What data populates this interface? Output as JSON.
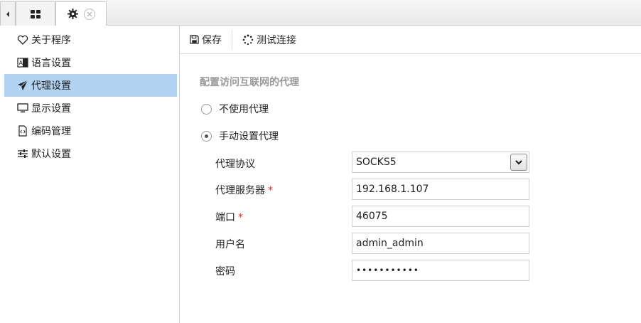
{
  "tabbar": {
    "apps_icon": "grid-icon",
    "settings_icon": "gear-icon",
    "close_icon": "close-icon"
  },
  "sidebar": {
    "items": [
      {
        "label": "关于程序",
        "icon": "heart-icon"
      },
      {
        "label": "语言设置",
        "icon": "language-icon"
      },
      {
        "label": "代理设置",
        "icon": "paper-plane-icon",
        "active": true
      },
      {
        "label": "显示设置",
        "icon": "monitor-icon"
      },
      {
        "label": "编码管理",
        "icon": "code-file-icon"
      },
      {
        "label": "默认设置",
        "icon": "sliders-icon"
      }
    ]
  },
  "toolbar": {
    "save_label": "保存",
    "test_label": "测试连接"
  },
  "proxy": {
    "section_title": "配置访问互联网的代理",
    "option_none": "不使用代理",
    "option_manual": "手动设置代理",
    "selected": "manual",
    "protocol_label": "代理协议",
    "protocol_value": "SOCKS5",
    "server_label": "代理服务器",
    "server_value": "192.168.1.107",
    "port_label": "端口",
    "port_value": "46075",
    "username_label": "用户名",
    "username_value": "admin_admin",
    "password_label": "密码",
    "password_value": "•••••••••••",
    "required_mark": "*"
  },
  "colors": {
    "active_item_bg": "#b3d3f3",
    "required": "#e03030",
    "section_title": "#999999"
  }
}
